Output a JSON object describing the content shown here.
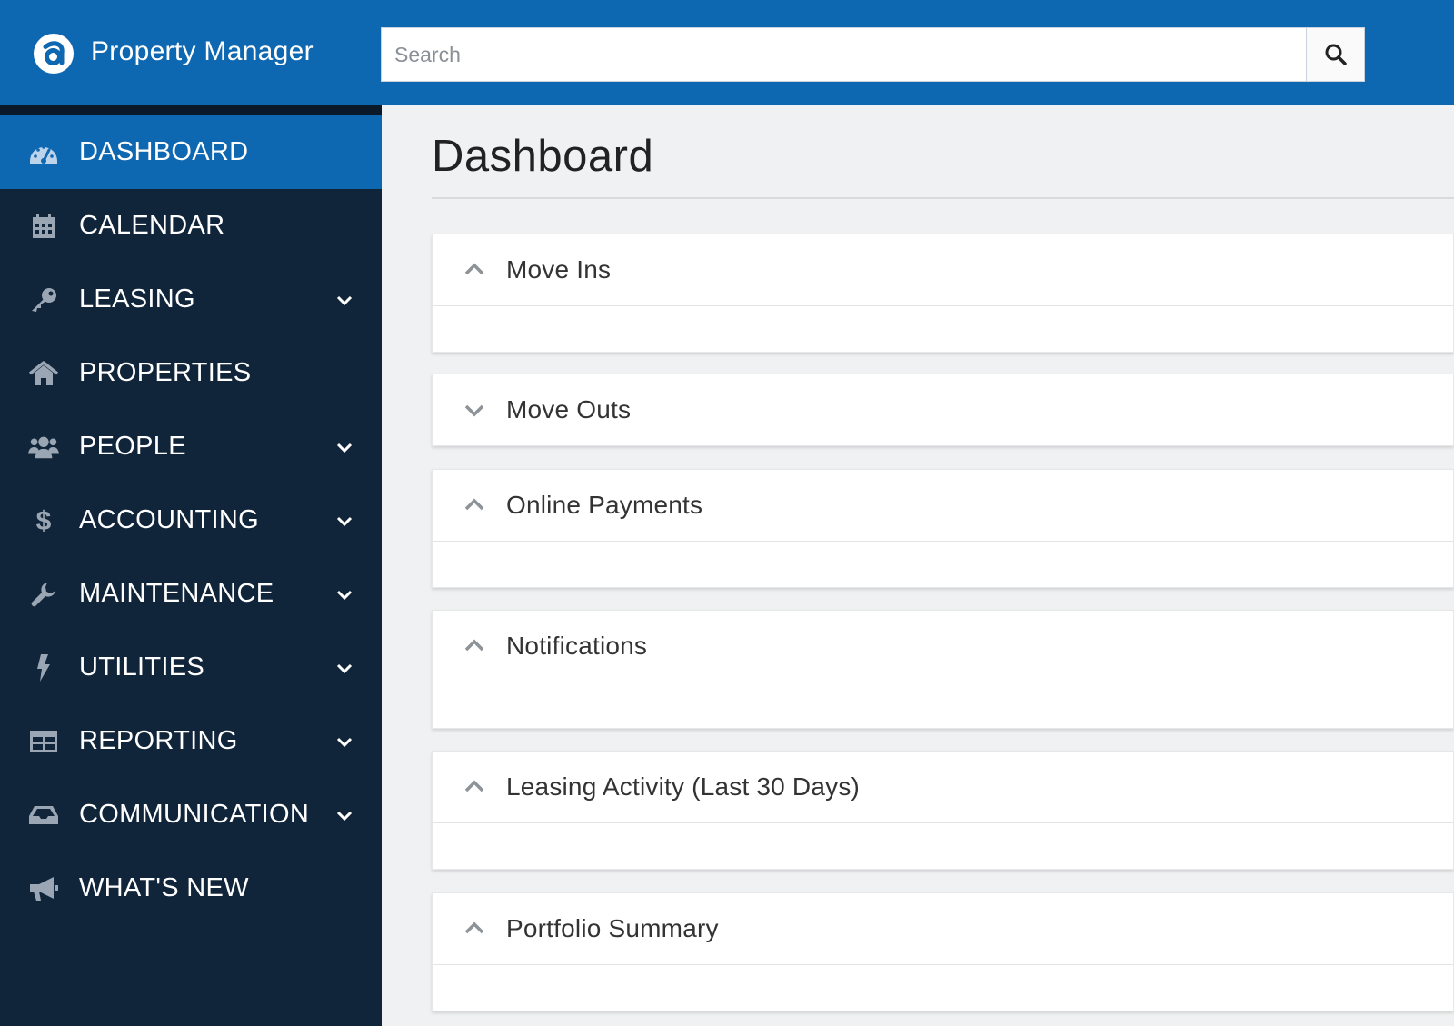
{
  "header": {
    "app_title": "Property Manager",
    "brand_color": "#0e67b1",
    "search_placeholder": "Search"
  },
  "sidebar": {
    "items": [
      {
        "label": "DASHBOARD",
        "icon": "speedometer-icon",
        "active": true
      },
      {
        "label": "CALENDAR",
        "icon": "calendar-icon"
      },
      {
        "label": "LEASING",
        "icon": "key-icon",
        "expandable": true
      },
      {
        "label": "PROPERTIES",
        "icon": "home-icon"
      },
      {
        "label": "PEOPLE",
        "icon": "users-icon",
        "expandable": true
      },
      {
        "label": "ACCOUNTING",
        "icon": "dollar-icon",
        "expandable": true
      },
      {
        "label": "MAINTENANCE",
        "icon": "wrench-icon",
        "expandable": true
      },
      {
        "label": "UTILITIES",
        "icon": "lightning-icon",
        "expandable": true
      },
      {
        "label": "REPORTING",
        "icon": "table-icon",
        "expandable": true
      },
      {
        "label": "COMMUNICATION",
        "icon": "inbox-icon",
        "expandable": true
      },
      {
        "label": "WHAT'S NEW",
        "icon": "megaphone-icon"
      }
    ],
    "background": "#10243a"
  },
  "main": {
    "title": "Dashboard",
    "panels": [
      {
        "title": "Move Ins",
        "expanded": true
      },
      {
        "title": "Move Outs",
        "expanded": false
      },
      {
        "title": "Online Payments",
        "expanded": true
      },
      {
        "title": "Notifications",
        "expanded": true
      },
      {
        "title": "Leasing Activity (Last 30 Days)",
        "expanded": true
      },
      {
        "title": "Portfolio Summary",
        "expanded": true
      }
    ]
  }
}
